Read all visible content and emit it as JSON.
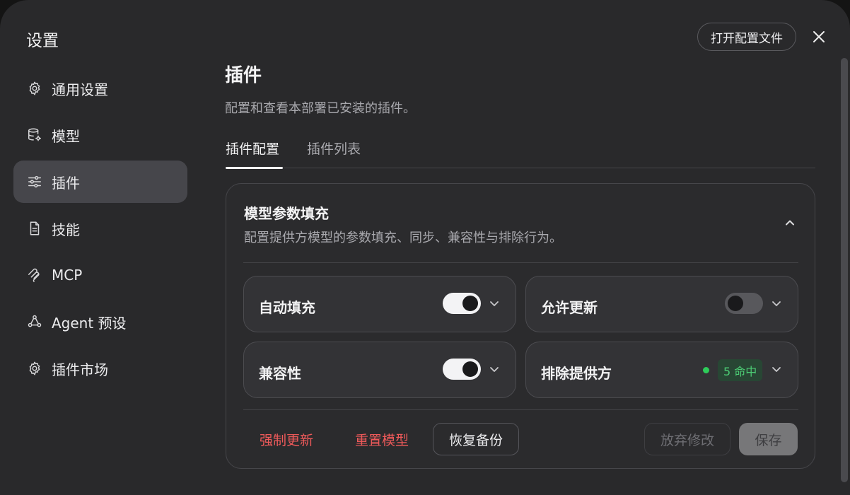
{
  "dialog": {
    "title": "设置",
    "open_config_label": "打开配置文件"
  },
  "sidebar": {
    "items": [
      {
        "label": "通用设置",
        "icon": "gear-icon",
        "active": false
      },
      {
        "label": "模型",
        "icon": "database-gear-icon",
        "active": false
      },
      {
        "label": "插件",
        "icon": "sliders-icon",
        "active": true
      },
      {
        "label": "技能",
        "icon": "document-icon",
        "active": false
      },
      {
        "label": "MCP",
        "icon": "mcp-icon",
        "active": false
      },
      {
        "label": "Agent 预设",
        "icon": "agent-nodes-icon",
        "active": false
      },
      {
        "label": "插件市场",
        "icon": "gear-icon",
        "active": false
      }
    ]
  },
  "main": {
    "title": "插件",
    "description": "配置和查看本部署已安装的插件。",
    "tabs": [
      {
        "label": "插件配置",
        "active": true
      },
      {
        "label": "插件列表",
        "active": false
      }
    ]
  },
  "card": {
    "title": "模型参数填充",
    "description": "配置提供方模型的参数填充、同步、兼容性与排除行为。",
    "options": [
      {
        "label": "自动填充",
        "enabled": true
      },
      {
        "label": "允许更新",
        "enabled": false
      },
      {
        "label": "兼容性",
        "enabled": true
      },
      {
        "label": "排除提供方",
        "badge": "5 命中"
      }
    ],
    "actions": {
      "force_update": "强制更新",
      "reset_model": "重置模型",
      "restore_backup": "恢复备份",
      "discard": "放弃修改",
      "save": "保存"
    }
  },
  "colors": {
    "background": "#29292b",
    "danger": "#ef5a5a",
    "success": "#2ecc5a"
  }
}
